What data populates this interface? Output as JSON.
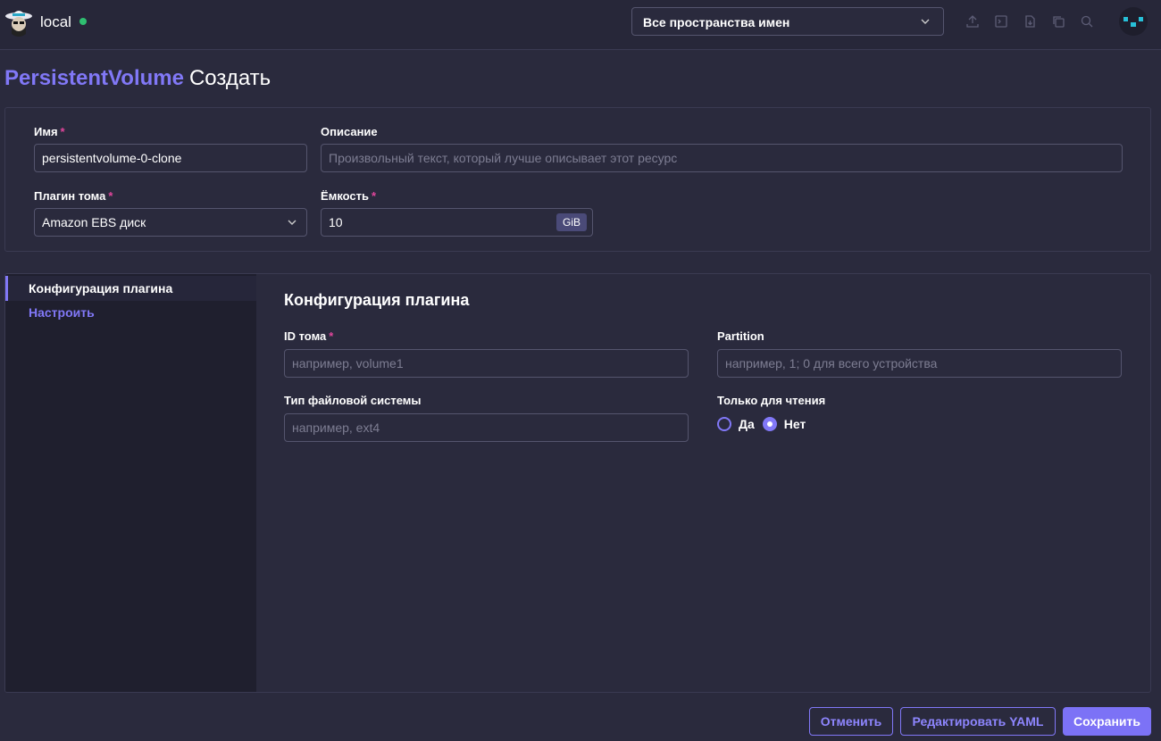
{
  "header": {
    "cluster_name": "local",
    "cluster_status_color": "#2fbf71",
    "namespace_select": "Все пространства имен",
    "toolbar_icons": [
      "upload-icon",
      "terminal-icon",
      "import-icon",
      "copy-icon",
      "search-icon"
    ]
  },
  "page": {
    "kind": "PersistentVolume",
    "action": "Создать"
  },
  "form": {
    "name": {
      "label": "Имя",
      "value": "persistentvolume-0-clone"
    },
    "description": {
      "label": "Описание",
      "placeholder": "Произвольный текст, который лучше описывает этот ресурс"
    },
    "volume_plugin": {
      "label": "Плагин тома",
      "value": "Amazon EBS диск"
    },
    "capacity": {
      "label": "Ёмкость",
      "value": "10",
      "unit": "GiB"
    },
    "required_mark": "*"
  },
  "sidenav": {
    "items": [
      {
        "label": "Конфигурация плагина",
        "active": true
      },
      {
        "label": "Настроить",
        "active": false
      }
    ]
  },
  "plugin_config": {
    "title": "Конфигурация плагина",
    "volume_id": {
      "label": "ID тома",
      "placeholder": "например, volume1"
    },
    "partition": {
      "label": "Partition",
      "placeholder": "например, 1; 0 для всего устройства"
    },
    "fs_type": {
      "label": "Тип файловой системы",
      "placeholder": "например, ext4"
    },
    "read_only": {
      "label": "Только для чтения",
      "options": [
        "Да",
        "Нет"
      ],
      "selected": "Нет"
    }
  },
  "footer": {
    "cancel": "Отменить",
    "edit_yaml": "Редактировать YAML",
    "save": "Сохранить"
  },
  "colors": {
    "accent": "#8178f7",
    "required": "#e0459b",
    "background": "#2a2a3d"
  }
}
